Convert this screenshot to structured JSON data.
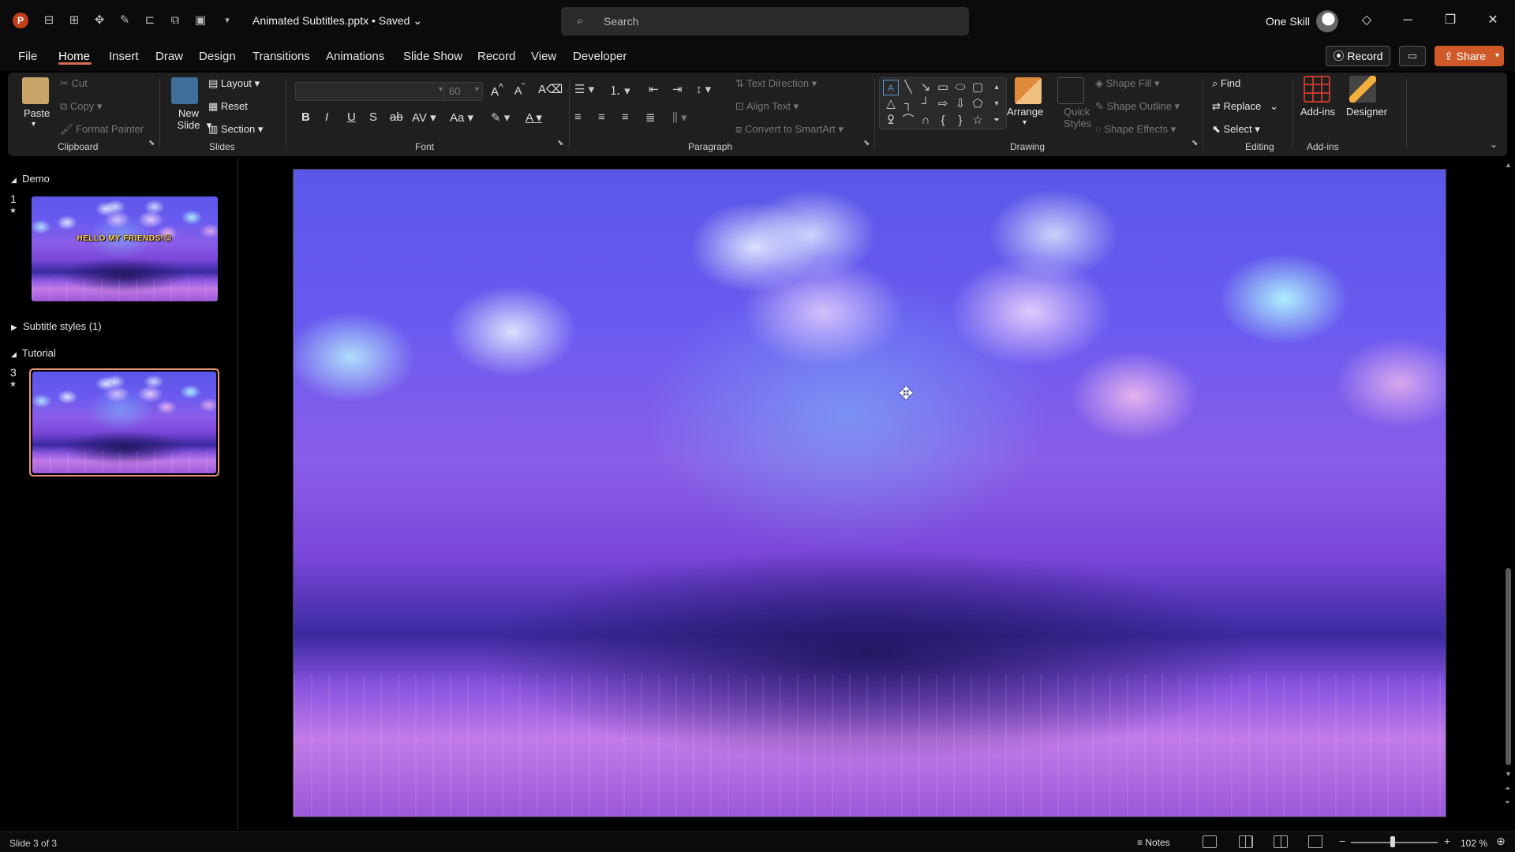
{
  "titlebar": {
    "app_logo": "P",
    "doc_title": "Animated Subtitles.pptx • Saved",
    "search_placeholder": "Search",
    "user_name": "One Skill"
  },
  "menu": {
    "tabs": [
      "File",
      "Home",
      "Insert",
      "Draw",
      "Design",
      "Transitions",
      "Animations",
      "Slide Show",
      "Record",
      "View",
      "Developer"
    ],
    "active": "Home",
    "record_label": "Record",
    "share_label": "Share"
  },
  "ribbon": {
    "clipboard": {
      "paste": "Paste",
      "cut": "Cut",
      "copy": "Copy",
      "format_painter": "Format Painter",
      "label": "Clipboard"
    },
    "slides": {
      "new_slide": "New Slide",
      "layout": "Layout",
      "reset": "Reset",
      "section": "Section",
      "label": "Slides"
    },
    "font": {
      "font_size": "60",
      "label": "Font"
    },
    "paragraph": {
      "text_direction": "Text Direction",
      "align_text": "Align Text",
      "convert_smartart": "Convert to SmartArt",
      "label": "Paragraph"
    },
    "drawing": {
      "arrange": "Arrange",
      "quick_styles": "Quick Styles",
      "shape_fill": "Shape Fill",
      "shape_outline": "Shape Outline",
      "shape_effects": "Shape Effects",
      "label": "Drawing"
    },
    "editing": {
      "find": "Find",
      "replace": "Replace",
      "select": "Select",
      "label": "Editing"
    },
    "addins": {
      "addins": "Add-ins",
      "designer": "Designer",
      "label": "Add-ins"
    }
  },
  "slides_panel": {
    "sections": [
      {
        "name": "Demo",
        "expanded": true
      },
      {
        "name": "Subtitle styles (1)",
        "expanded": false
      },
      {
        "name": "Tutorial",
        "expanded": true
      }
    ],
    "slides": [
      {
        "number": "1",
        "text": "HELLO MY FRIENDS!😊"
      },
      {
        "number": "3",
        "text": ""
      }
    ]
  },
  "status": {
    "slide_count": "Slide 3 of 3",
    "notes": "Notes",
    "zoom": "102 %"
  },
  "colors": {
    "accent": "#d86b52",
    "share": "#d0592a",
    "selected_thumb_border": "#e9967a"
  }
}
